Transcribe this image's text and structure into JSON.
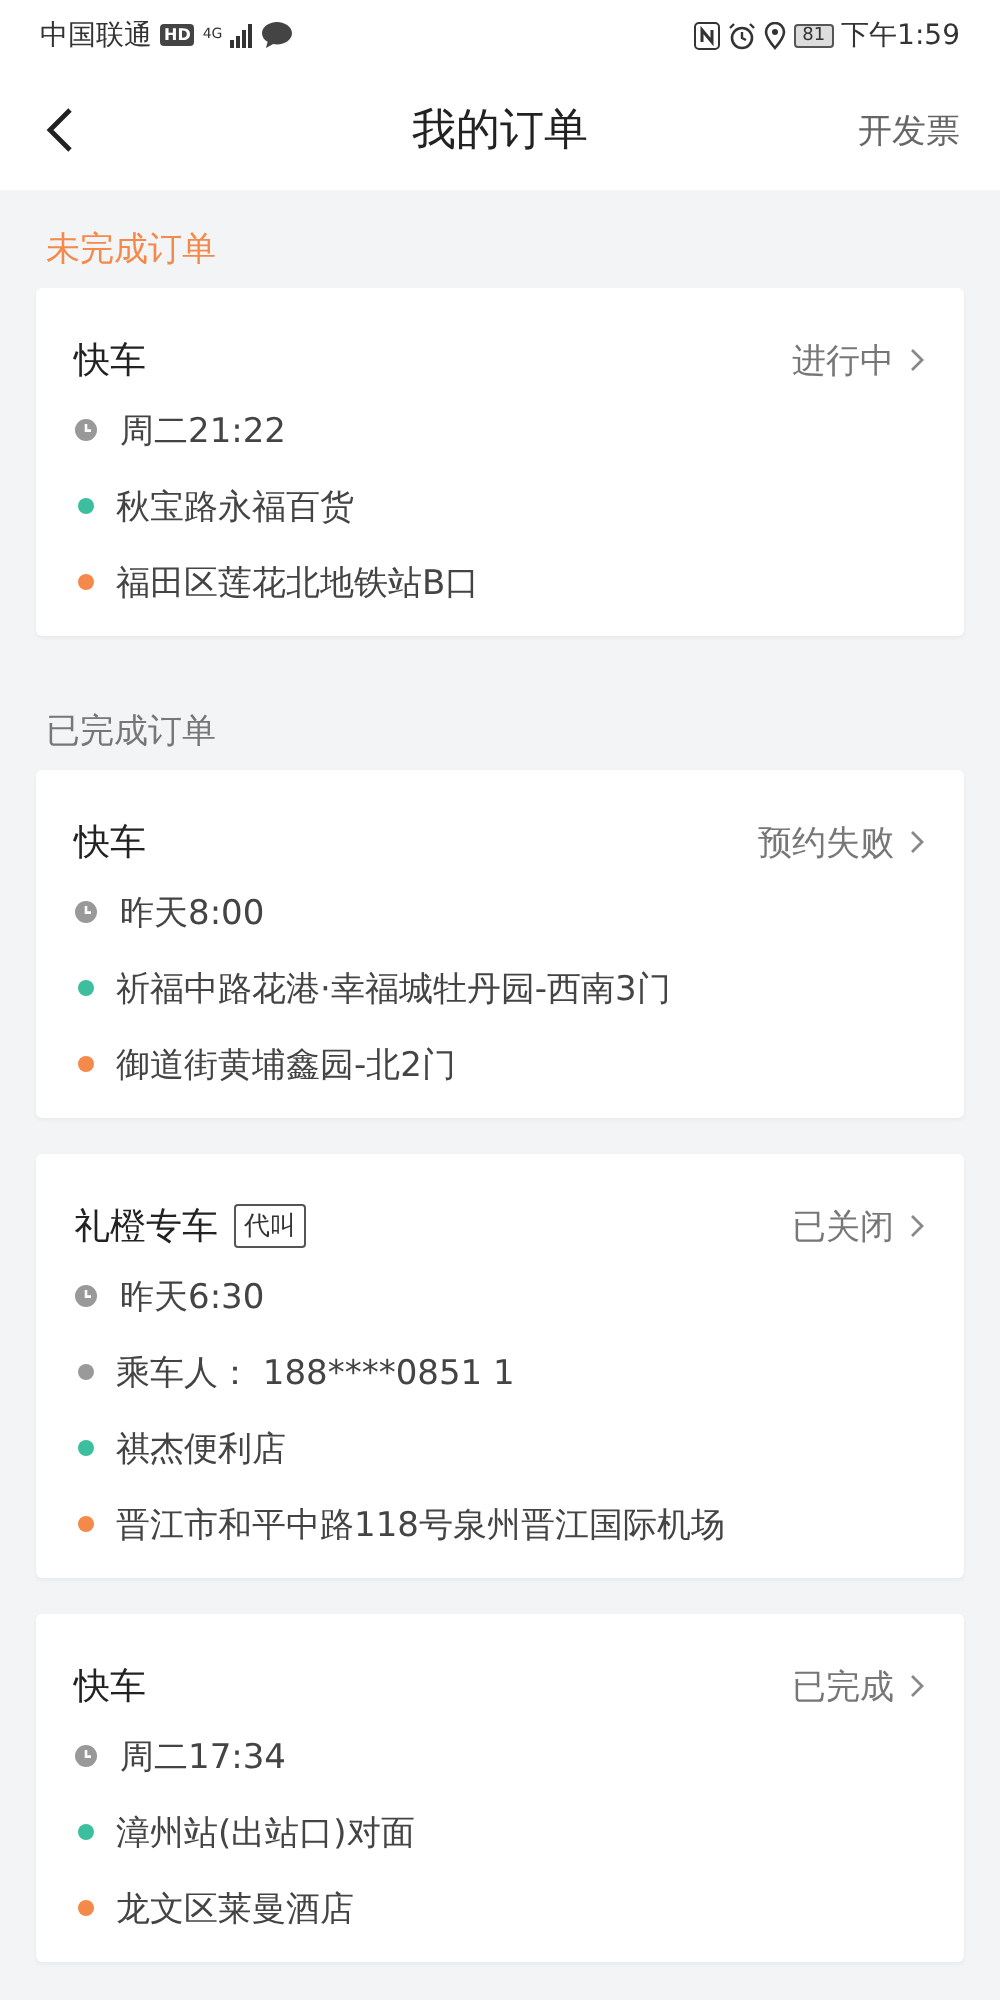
{
  "status_bar": {
    "carrier": "中国联通",
    "hd_badge": "HD",
    "network": "4G",
    "battery": "81",
    "time": "下午1:59"
  },
  "header": {
    "title": "我的订单",
    "action": "开发票"
  },
  "sections": [
    {
      "title": "未完成订单",
      "kind": "pending",
      "orders": [
        {
          "title": "快车",
          "status": "进行中",
          "rows": [
            {
              "kind": "time",
              "text": "周二21:22"
            },
            {
              "kind": "place",
              "color": "#3dbf9f",
              "text": "秋宝路永福百货"
            },
            {
              "kind": "place",
              "color": "#f5894a",
              "text": "福田区莲花北地铁站B口"
            }
          ]
        }
      ]
    },
    {
      "title": "已完成订单",
      "kind": "done",
      "orders": [
        {
          "title": "快车",
          "status": "预约失败",
          "rows": [
            {
              "kind": "time",
              "text": "昨天8:00"
            },
            {
              "kind": "place",
              "color": "#3dbf9f",
              "text": "祈福中路花港·幸福城牡丹园-西南3门"
            },
            {
              "kind": "place",
              "color": "#f5894a",
              "text": "御道街黄埔鑫园-北2门"
            }
          ]
        },
        {
          "title": "礼橙专车",
          "tag": "代叫",
          "status": "已关闭",
          "rows": [
            {
              "kind": "time",
              "text": "昨天6:30"
            },
            {
              "kind": "place",
              "color": "#9a9a9a",
              "text": "乘车人： 188****0851 1"
            },
            {
              "kind": "place",
              "color": "#3dbf9f",
              "text": "祺杰便利店"
            },
            {
              "kind": "place",
              "color": "#f5894a",
              "text": "晋江市和平中路118号泉州晋江国际机场"
            }
          ]
        },
        {
          "title": "快车",
          "status": "已完成",
          "rows": [
            {
              "kind": "time",
              "text": "周二17:34"
            },
            {
              "kind": "place",
              "color": "#3dbf9f",
              "text": "漳州站(出站口)对面"
            },
            {
              "kind": "place",
              "color": "#f5894a",
              "text": "龙文区莱曼酒店"
            }
          ]
        }
      ]
    }
  ]
}
